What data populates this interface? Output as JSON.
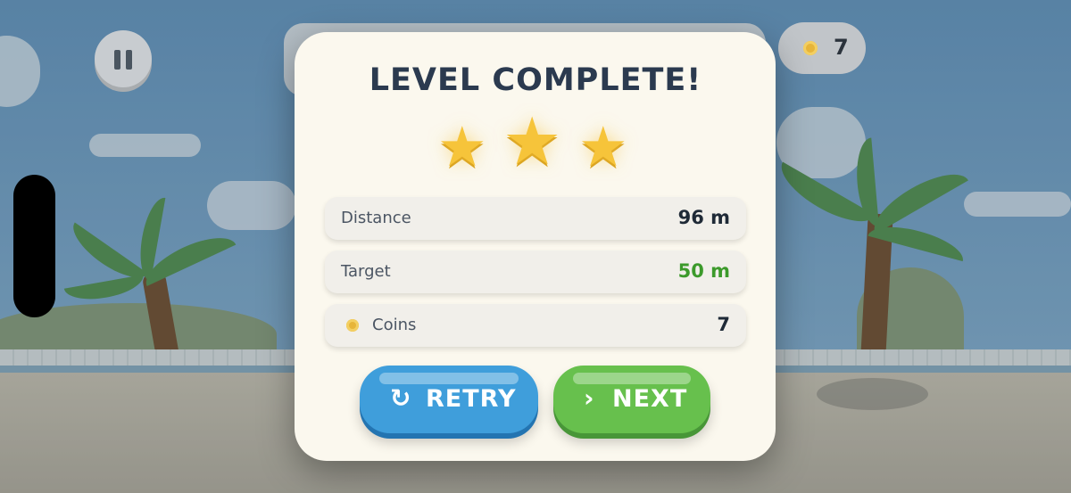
{
  "hud": {
    "coins": "7",
    "pause_icon": "pause-icon",
    "coin_icon": "coin-icon"
  },
  "modal": {
    "title": "LEVEL COMPLETE!",
    "stars_earned": 3,
    "stars_total": 3,
    "rows": [
      {
        "label": "Distance",
        "value": "96 m",
        "value_color": "#1f2a37"
      },
      {
        "label": "Target",
        "value": "50 m",
        "value_color": "#3c9a2b"
      },
      {
        "label": "Coins",
        "value": "7",
        "value_color": "#1f2a37",
        "icon": "coin-icon"
      }
    ],
    "buttons": {
      "retry": {
        "label": "RETRY",
        "icon": "retry-icon",
        "color": "#3f9edb"
      },
      "next": {
        "label": "NEXT",
        "icon": "chevron-right-icon",
        "color": "#67c04d"
      }
    }
  },
  "colors": {
    "star": "#f6c43a",
    "title": "#2b3a4f",
    "panel": "#fbf8ee"
  }
}
